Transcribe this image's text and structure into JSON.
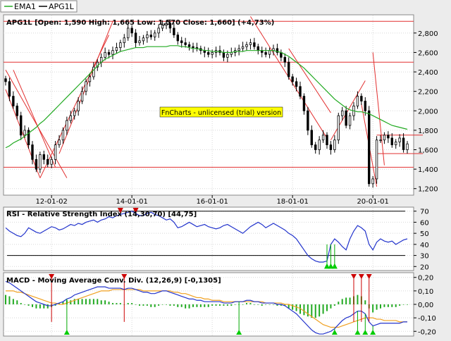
{
  "chart_data": [
    {
      "type": "candlestick",
      "title": "APG1L [Open: 1,590  High: 1,665  Low: 1,570  Close: 1,660] (+4,73%)",
      "legend": [
        {
          "name": "EMA1",
          "color": "#22aa22"
        },
        {
          "name": "APG1L",
          "color": "#000000"
        }
      ],
      "x_tick_labels": [
        "12-01-02",
        "14-01-01",
        "16-01-01",
        "18-01-01",
        "20-01-01"
      ],
      "y_ticks": [
        1.2,
        1.4,
        1.6,
        1.8,
        2.0,
        2.2,
        2.4,
        2.6,
        2.8
      ],
      "y_tick_labels": [
        "1,200",
        "1,400",
        "1,600",
        "1,800",
        "2,000",
        "2,200",
        "2,400",
        "2,600",
        "2,800"
      ],
      "ylim": [
        1.14,
        2.98
      ],
      "watermark": "FnCharts - unlicensed (trial) version",
      "close": [
        2.3,
        2.15,
        2.05,
        1.95,
        1.75,
        1.8,
        1.65,
        1.5,
        1.4,
        1.55,
        1.5,
        1.45,
        1.5,
        1.65,
        1.7,
        1.8,
        1.9,
        1.95,
        2.0,
        2.1,
        2.2,
        2.3,
        2.35,
        2.45,
        2.5,
        2.55,
        2.6,
        2.58,
        2.62,
        2.65,
        2.7,
        2.75,
        2.85,
        2.8,
        2.7,
        2.72,
        2.75,
        2.78,
        2.76,
        2.8,
        2.85,
        2.88,
        2.9,
        2.85,
        2.78,
        2.72,
        2.7,
        2.68,
        2.66,
        2.65,
        2.64,
        2.62,
        2.6,
        2.58,
        2.6,
        2.62,
        2.6,
        2.55,
        2.58,
        2.6,
        2.62,
        2.64,
        2.66,
        2.68,
        2.7,
        2.66,
        2.62,
        2.6,
        2.58,
        2.62,
        2.64,
        2.6,
        2.55,
        2.5,
        2.35,
        2.3,
        2.25,
        2.15,
        2.0,
        1.8,
        1.65,
        1.6,
        1.7,
        1.75,
        1.65,
        1.6,
        1.7,
        1.95,
        2.0,
        1.85,
        1.95,
        2.05,
        2.15,
        2.1,
        2.0,
        1.25,
        1.3,
        1.7,
        1.7,
        1.75,
        1.72,
        1.65,
        1.68,
        1.72,
        1.6,
        1.66
      ],
      "ema": [
        1.62,
        1.64,
        1.67,
        1.69,
        1.71,
        1.74,
        1.77,
        1.8,
        1.83,
        1.87,
        1.9,
        1.94,
        1.98,
        2.02,
        2.06,
        2.1,
        2.14,
        2.18,
        2.22,
        2.26,
        2.3,
        2.34,
        2.38,
        2.42,
        2.46,
        2.5,
        2.53,
        2.55,
        2.57,
        2.59,
        2.61,
        2.62,
        2.63,
        2.64,
        2.65,
        2.65,
        2.65,
        2.66,
        2.66,
        2.66,
        2.66,
        2.66,
        2.66,
        2.67,
        2.67,
        2.67,
        2.66,
        2.66,
        2.65,
        2.64,
        2.64,
        2.63,
        2.62,
        2.62,
        2.61,
        2.61,
        2.61,
        2.6,
        2.6,
        2.6,
        2.61,
        2.61,
        2.61,
        2.62,
        2.62,
        2.62,
        2.62,
        2.62,
        2.62,
        2.62,
        2.62,
        2.61,
        2.6,
        2.58,
        2.56,
        2.53,
        2.5,
        2.47,
        2.44,
        2.4,
        2.36,
        2.32,
        2.28,
        2.24,
        2.2,
        2.16,
        2.12,
        2.09,
        2.06,
        2.03,
        2.01,
        2.0,
        1.99,
        1.99,
        1.98,
        1.97,
        1.95,
        1.93,
        1.91,
        1.89,
        1.87,
        1.85,
        1.84,
        1.83,
        1.82,
        1.81
      ]
    },
    {
      "type": "line",
      "title": "RSI - Relative Strength Index (14,30,70) [44,75]",
      "y_ticks": [
        20,
        30,
        40,
        50,
        60,
        70
      ],
      "y_tick_labels": [
        "20",
        "30",
        "40",
        "50",
        "60",
        "70"
      ],
      "ylim": [
        17,
        73
      ],
      "levels": [
        30,
        70
      ],
      "values": [
        55,
        52,
        50,
        48,
        47,
        50,
        55,
        53,
        51,
        50,
        52,
        54,
        56,
        55,
        53,
        54,
        56,
        58,
        57,
        59,
        58,
        60,
        61,
        62,
        60,
        62,
        63,
        65,
        64,
        66,
        67,
        68,
        69,
        70,
        68,
        66,
        66,
        68,
        69,
        67,
        66,
        64,
        62,
        63,
        60,
        55,
        56,
        58,
        60,
        58,
        56,
        57,
        58,
        56,
        55,
        54,
        55,
        57,
        58,
        56,
        54,
        52,
        50,
        53,
        56,
        58,
        60,
        58,
        55,
        57,
        59,
        57,
        55,
        53,
        50,
        48,
        45,
        40,
        35,
        30,
        27,
        25,
        24,
        24,
        25,
        40,
        45,
        42,
        38,
        35,
        45,
        52,
        57,
        55,
        52,
        40,
        35,
        42,
        45,
        43,
        42,
        43,
        40,
        42,
        44,
        45
      ]
    },
    {
      "type": "line",
      "title": "MACD - Moving Average Conv. Div. (12,26,9) [-0,1305]",
      "y_ticks": [
        0.2,
        0.1,
        0.0,
        -0.1,
        -0.2
      ],
      "y_tick_labels": [
        "0,20",
        "0,10",
        "0,00",
        "-0,10",
        "-0,20"
      ],
      "ylim": [
        -0.23,
        0.23
      ],
      "macd": [
        0.17,
        0.16,
        0.14,
        0.12,
        0.1,
        0.08,
        0.06,
        0.04,
        0.02,
        0.01,
        0.0,
        -0.01,
        -0.01,
        0.0,
        0.01,
        0.02,
        0.04,
        0.05,
        0.07,
        0.08,
        0.09,
        0.1,
        0.11,
        0.12,
        0.13,
        0.13,
        0.13,
        0.12,
        0.12,
        0.12,
        0.12,
        0.11,
        0.12,
        0.12,
        0.11,
        0.1,
        0.09,
        0.09,
        0.08,
        0.08,
        0.09,
        0.1,
        0.1,
        0.09,
        0.08,
        0.07,
        0.06,
        0.05,
        0.04,
        0.04,
        0.03,
        0.03,
        0.02,
        0.02,
        0.02,
        0.02,
        0.02,
        0.01,
        0.01,
        0.01,
        0.02,
        0.02,
        0.02,
        0.03,
        0.03,
        0.02,
        0.02,
        0.01,
        0.01,
        0.01,
        0.01,
        0.0,
        0.0,
        -0.01,
        -0.03,
        -0.05,
        -0.07,
        -0.1,
        -0.13,
        -0.16,
        -0.19,
        -0.21,
        -0.22,
        -0.22,
        -0.21,
        -0.2,
        -0.18,
        -0.15,
        -0.12,
        -0.1,
        -0.09,
        -0.07,
        -0.05,
        -0.05,
        -0.07,
        -0.13,
        -0.16,
        -0.15,
        -0.14,
        -0.14,
        -0.14,
        -0.14,
        -0.14,
        -0.14,
        -0.13,
        -0.13
      ],
      "signal": [
        0.1,
        0.1,
        0.1,
        0.09,
        0.09,
        0.08,
        0.07,
        0.06,
        0.05,
        0.04,
        0.03,
        0.02,
        0.01,
        0.01,
        0.0,
        0.0,
        0.01,
        0.02,
        0.03,
        0.04,
        0.05,
        0.06,
        0.07,
        0.08,
        0.09,
        0.1,
        0.1,
        0.1,
        0.11,
        0.11,
        0.11,
        0.11,
        0.11,
        0.11,
        0.11,
        0.11,
        0.1,
        0.1,
        0.1,
        0.1,
        0.1,
        0.1,
        0.1,
        0.1,
        0.09,
        0.09,
        0.08,
        0.08,
        0.07,
        0.06,
        0.05,
        0.05,
        0.04,
        0.04,
        0.03,
        0.03,
        0.03,
        0.02,
        0.02,
        0.02,
        0.02,
        0.02,
        0.02,
        0.02,
        0.02,
        0.02,
        0.02,
        0.02,
        0.01,
        0.01,
        0.01,
        0.01,
        0.01,
        0.0,
        0.0,
        -0.01,
        -0.02,
        -0.03,
        -0.05,
        -0.07,
        -0.09,
        -0.11,
        -0.13,
        -0.15,
        -0.16,
        -0.17,
        -0.17,
        -0.17,
        -0.16,
        -0.15,
        -0.14,
        -0.13,
        -0.12,
        -0.11,
        -0.1,
        -0.1,
        -0.1,
        -0.11,
        -0.11,
        -0.12,
        -0.12,
        -0.12,
        -0.12,
        -0.13,
        -0.13,
        -0.13
      ]
    }
  ]
}
